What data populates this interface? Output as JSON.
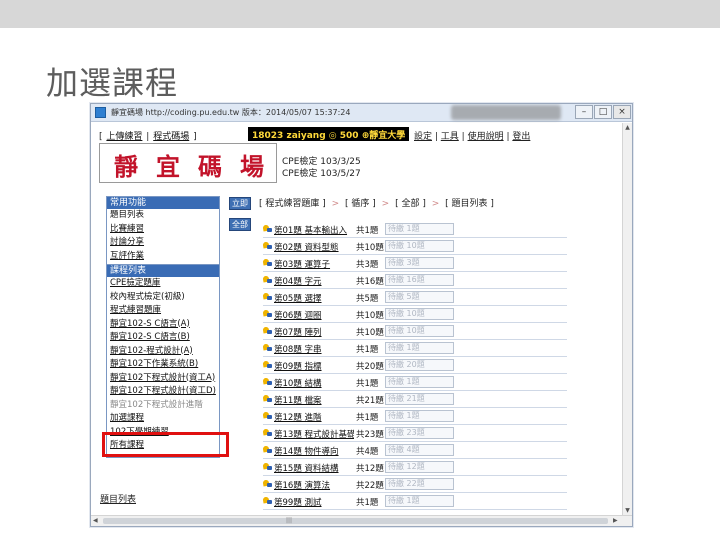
{
  "slide": {
    "title": "加選課程"
  },
  "window": {
    "title": "靜宜碼場 http://coding.pu.edu.tw  版本：2014/05/07 15:37:24",
    "controls": {
      "minimize": "–",
      "maximize": "□",
      "close": "×"
    }
  },
  "topnav": {
    "open": "[",
    "left": [
      {
        "label": "上傳練習"
      },
      {
        "label": "程式碼場"
      }
    ],
    "close": "]"
  },
  "user": {
    "id": "18023",
    "name": "zaiyang",
    "score": "◎ 500",
    "school": "⊕靜宜大學"
  },
  "usernav": [
    {
      "label": "設定"
    },
    {
      "label": "工具"
    },
    {
      "label": "使用說明"
    },
    {
      "label": "登出"
    }
  ],
  "logo": {
    "text": "靜宜碼場"
  },
  "cpe": {
    "line1": "CPE檢定 103/3/25",
    "line2": "CPE檢定 103/5/27"
  },
  "panels": {
    "common": {
      "header": "常用功能",
      "items": [
        {
          "label": "題目列表",
          "style": ""
        },
        {
          "label": "比賽練習",
          "style": "u"
        },
        {
          "label": "討論分享",
          "style": "u"
        },
        {
          "label": "互評作業",
          "style": "u"
        }
      ]
    },
    "courses": {
      "header": "課程列表",
      "items": [
        {
          "label": "CPE檢定題庫",
          "style": "u"
        },
        {
          "label": "校內程式檢定(初級)",
          "style": ""
        },
        {
          "label": "程式練習題庫",
          "style": "u"
        },
        {
          "label": "靜宜102-S C語言(A)",
          "style": "u"
        },
        {
          "label": "靜宜102-S C語言(B)",
          "style": "u"
        },
        {
          "label": "靜宜102-程式設計(A)",
          "style": "u"
        },
        {
          "label": "靜宜102下作業系統(B)",
          "style": "u"
        },
        {
          "label": "靜宜102下程式設計(資工A)",
          "style": "u"
        },
        {
          "label": "靜宜102下程式設計(資工D)",
          "style": "u"
        },
        {
          "label": "靜宜102下程式設計進階",
          "style": "fade"
        },
        {
          "label": "加選課程",
          "style": "u"
        },
        {
          "label": "102下學期練習",
          "style": "u"
        },
        {
          "label": "所有課程",
          "style": "u"
        }
      ]
    }
  },
  "side_buttons": {
    "top": "立即",
    "bottom": "全部"
  },
  "breadcrumb": {
    "items": [
      "[ 程式練習題庫 ]",
      "[ 循序 ]",
      "[ 全部 ]",
      "[ 題目列表 ]"
    ],
    "sep": ">"
  },
  "problems": [
    {
      "name": "第01題 基本輸出入",
      "count": "共1題",
      "entry": "待繳 1題"
    },
    {
      "name": "第02題 資料型態",
      "count": "共10題",
      "entry": "待繳 10題"
    },
    {
      "name": "第03題 運算子",
      "count": "共3題",
      "entry": "待繳 3題"
    },
    {
      "name": "第04題 字元",
      "count": "共16題",
      "entry": "待繳 16題"
    },
    {
      "name": "第05題 選擇",
      "count": "共5題",
      "entry": "待繳 5題"
    },
    {
      "name": "第06題 迴圈",
      "count": "共10題",
      "entry": "待繳 10題"
    },
    {
      "name": "第07題 陣列",
      "count": "共10題",
      "entry": "待繳 10題"
    },
    {
      "name": "第08題 字串",
      "count": "共1題",
      "entry": "待繳 1題"
    },
    {
      "name": "第09題 指標",
      "count": "共20題",
      "entry": "待繳 20題"
    },
    {
      "name": "第10題 結構",
      "count": "共1題",
      "entry": "待繳 1題"
    },
    {
      "name": "第11題 檔案",
      "count": "共21題",
      "entry": "待繳 21題"
    },
    {
      "name": "第12題 進階",
      "count": "共1題",
      "entry": "待繳 1題"
    },
    {
      "name": "第13題 程式設計基礎",
      "count": "共23題",
      "entry": "待繳 23題"
    },
    {
      "name": "第14題 物件導向",
      "count": "共4題",
      "entry": "待繳 4題"
    },
    {
      "name": "第15題 資料結構",
      "count": "共12題",
      "entry": "待繳 12題"
    },
    {
      "name": "第16題 演算法",
      "count": "共22題",
      "entry": "待繳 22題"
    },
    {
      "name": "第99題 測試",
      "count": "共1題",
      "entry": "待繳 1題"
    }
  ],
  "bottom_link": "題目列表",
  "colors": {
    "panel_header": "#3a6cb5",
    "highlight": "#e01010",
    "logo": "#c2132a",
    "user_text": "#ffd93a"
  }
}
